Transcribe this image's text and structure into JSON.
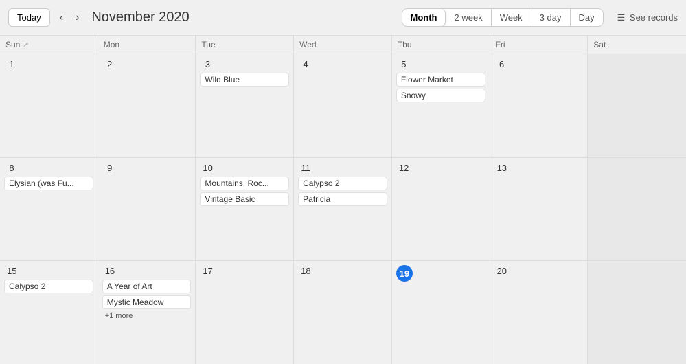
{
  "header": {
    "today_label": "Today",
    "title": "November 2020",
    "views": [
      "Month",
      "2 week",
      "Week",
      "3 day",
      "Day"
    ],
    "active_view": "Month",
    "see_records": "See records"
  },
  "day_headers": [
    {
      "label": "Sun",
      "sort": true
    },
    {
      "label": "Mon"
    },
    {
      "label": "Tue"
    },
    {
      "label": "Wed"
    },
    {
      "label": "Thu"
    },
    {
      "label": "Fri"
    },
    {
      "label": "Sat"
    }
  ],
  "weeks": [
    {
      "days": [
        {
          "num": "1",
          "events": []
        },
        {
          "num": "2",
          "events": []
        },
        {
          "num": "3",
          "events": [
            {
              "label": "Wild Blue"
            }
          ]
        },
        {
          "num": "4",
          "events": []
        },
        {
          "num": "5",
          "events": [
            {
              "label": "Flower Market"
            },
            {
              "label": "Snowy"
            }
          ]
        },
        {
          "num": "6",
          "events": []
        },
        {
          "num": "",
          "events": []
        }
      ]
    },
    {
      "days": [
        {
          "num": "8",
          "events": [
            {
              "label": "Elysian (was Fu..."
            }
          ]
        },
        {
          "num": "9",
          "events": []
        },
        {
          "num": "10",
          "events": [
            {
              "label": "Mountains, Roc..."
            },
            {
              "label": "Vintage Basic"
            }
          ]
        },
        {
          "num": "11",
          "events": [
            {
              "label": "Calypso 2"
            },
            {
              "label": "Patricia"
            }
          ]
        },
        {
          "num": "12",
          "events": []
        },
        {
          "num": "13",
          "events": []
        },
        {
          "num": "",
          "events": []
        }
      ]
    },
    {
      "days": [
        {
          "num": "15",
          "events": [
            {
              "label": "Calypso 2"
            }
          ]
        },
        {
          "num": "16",
          "events": [
            {
              "label": "A Year of Art"
            },
            {
              "label": "Mystic Meadow"
            }
          ],
          "more": "+1 more"
        },
        {
          "num": "17",
          "events": []
        },
        {
          "num": "18",
          "events": []
        },
        {
          "num": "19",
          "events": [],
          "today": true
        },
        {
          "num": "20",
          "events": []
        },
        {
          "num": "",
          "events": []
        }
      ]
    }
  ],
  "colors": {
    "today_bg": "#1a73e8",
    "today_text": "#ffffff"
  }
}
